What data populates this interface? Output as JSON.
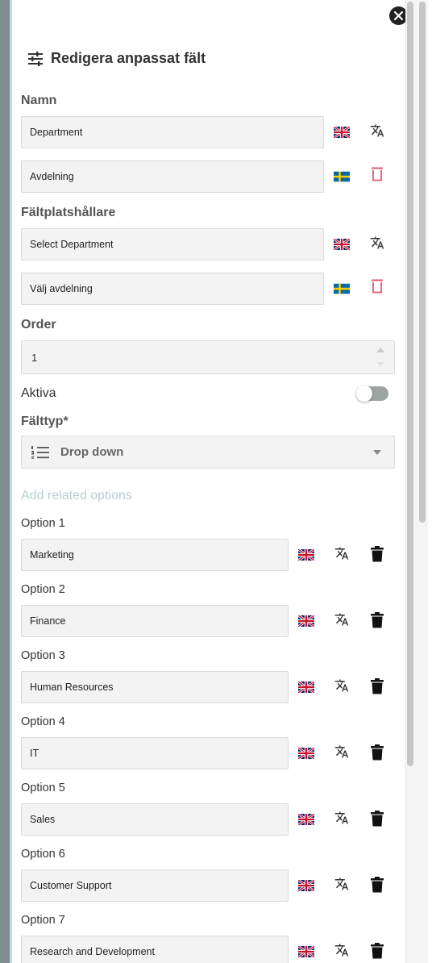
{
  "panel": {
    "title": "Redigera anpassat fält"
  },
  "name_section": {
    "label": "Namn",
    "en_value": "Department",
    "sv_value": "Avdelning"
  },
  "placeholder_section": {
    "label": "Fältplatshållare",
    "en_value": "Select Department",
    "sv_value": "Välj avdelning"
  },
  "order": {
    "label": "Order",
    "value": "1"
  },
  "active": {
    "label": "Aktiva",
    "on": false
  },
  "field_type": {
    "label": "Fälttyp*",
    "value": "Drop down"
  },
  "related": {
    "label": "Add related options"
  },
  "options": [
    {
      "label": "Option 1",
      "value": "Marketing"
    },
    {
      "label": "Option 2",
      "value": "Finance"
    },
    {
      "label": "Option 3",
      "value": "Human Resources"
    },
    {
      "label": "Option 4",
      "value": "IT"
    },
    {
      "label": "Option 5",
      "value": "Sales"
    },
    {
      "label": "Option 6",
      "value": "Customer Support"
    },
    {
      "label": "Option 7",
      "value": "Research and Development"
    }
  ],
  "icons": {
    "close": "close-icon",
    "tune": "tune-icon",
    "flag_en": "flag-uk-icon",
    "flag_sv": "flag-sweden-icon",
    "translate": "translate-icon",
    "delete_outline": "delete-outline-icon",
    "delete": "trash-icon",
    "list": "list-numbered-icon"
  },
  "colors": {
    "accent_border": "#b9dfe3",
    "delete_red": "#e05a6d",
    "muted_link": "#b7cfd1"
  }
}
